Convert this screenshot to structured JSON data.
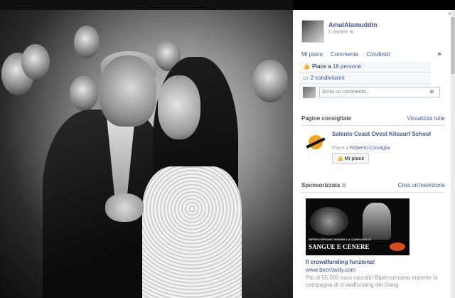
{
  "post": {
    "author": "AmalAlamuddin",
    "date": "6 ottobre",
    "globe_icon": "globe-icon"
  },
  "actions": {
    "like": "Mi piace",
    "comment": "Commenta",
    "share": "Condividi",
    "separator": "·"
  },
  "ufi": {
    "likes_prefix": "Piace a ",
    "likes_link": "18 persone.",
    "shares_link": "2 condivisioni",
    "comment_placeholder": "Scrivi un commento..."
  },
  "suggested_pages": {
    "title": "Pagine consigliate",
    "see_all": "Visualizza tutte",
    "page_name": "Salento Coast Ovest Kitesurf School",
    "likers_prefix": "Piace a ",
    "likers_link": "Roberto Corvaglia",
    "like_button": "Mi piace"
  },
  "sponsored": {
    "title": "Sponsorizzata",
    "create_ad": "Crea un'inserzione",
    "ad_title": "Il crowdfunding funziona!",
    "ad_url": "www.becrowdy.com",
    "ad_text": "Più di 55.000 euro raccolti! Ripercorriamo insieme la campagna di crowdfunding del Gang.",
    "image_caption": "RIPERCORRIAMO INSIEME LA CAMPAGNA DI",
    "image_headline": "SANGUE E CENERE",
    "image_brand": "Gang"
  },
  "close_label": "×",
  "colors": {
    "link": "#3b5998",
    "muted": "#90949c",
    "ufi_background": "#f6f7f9"
  }
}
